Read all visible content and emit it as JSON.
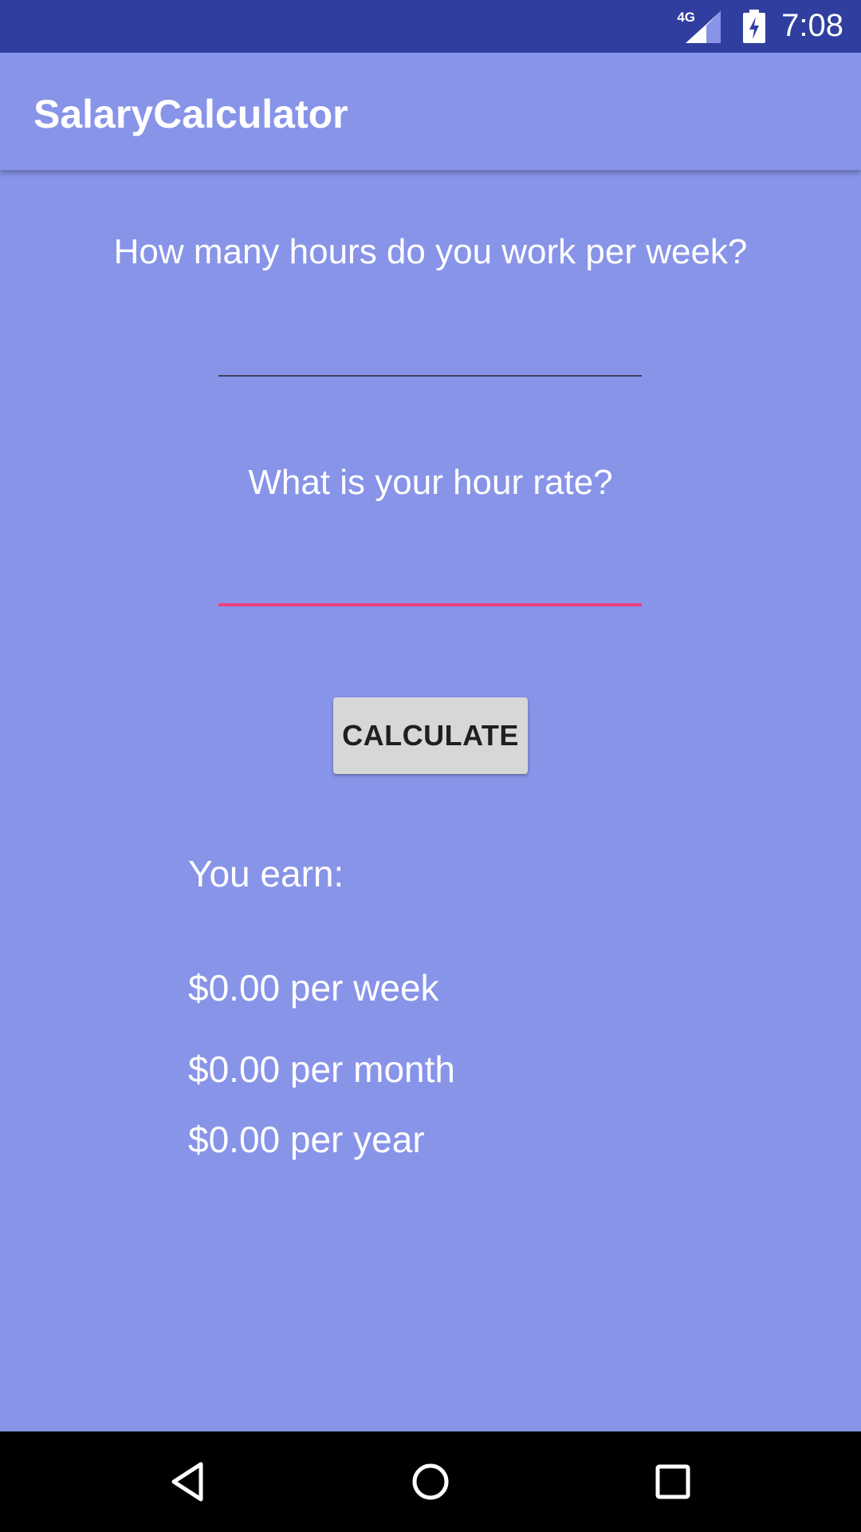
{
  "status_bar": {
    "time": "7:08",
    "network": "4G",
    "icons": [
      "signal-icon",
      "battery-charging-icon"
    ]
  },
  "app_bar": {
    "title": "SalaryCalculator"
  },
  "form": {
    "hours_question": "How many hours do you work per week?",
    "hours_value": "",
    "rate_question": "What is your hour rate?",
    "rate_value": "",
    "calculate_label": "CALCULATE"
  },
  "results": {
    "label": "You earn:",
    "per_week": "$0.00 per week",
    "per_month": "$0.00 per month",
    "per_year": "$0.00 per year"
  },
  "nav_bar": {
    "icons": [
      "back-icon",
      "home-icon",
      "recent-apps-icon"
    ]
  },
  "colors": {
    "status_bar": "#303f9f",
    "background": "#8894e8",
    "accent": "#ec407a",
    "button": "#d6d7d7"
  }
}
